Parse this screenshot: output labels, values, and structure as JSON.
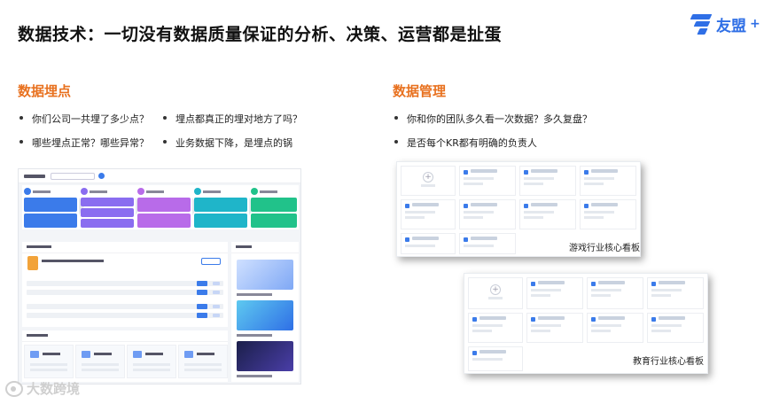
{
  "title": "数据技术：一切没有数据质量保证的分析、决策、运营都是扯蛋",
  "brand": {
    "name": "友盟",
    "suffix": "+",
    "color": "#2f6fe6"
  },
  "left_section": {
    "heading": "数据埋点",
    "bullets": [
      "你们公司一共埋了多少点？",
      "埋点都真正的埋对地方了吗？",
      "哪些埋点正常？哪些异常？",
      "业务数据下降，是埋点的锅"
    ]
  },
  "right_section": {
    "heading": "数据管理",
    "bullets": [
      "你和你的团队多久看一次数据？多久复盘？",
      "是否每个KR都有明确的负责人"
    ]
  },
  "boards": [
    {
      "label": "游戏行业核心看板"
    },
    {
      "label": "教育行业核心看板"
    }
  ],
  "dashboard_mock": {
    "step_colors": [
      "#3b7bea",
      "#8a6df0",
      "#b86be9",
      "#1fb5c9",
      "#21c28a"
    ]
  },
  "watermark": "大数跨境",
  "accent_color": "#e8711f"
}
